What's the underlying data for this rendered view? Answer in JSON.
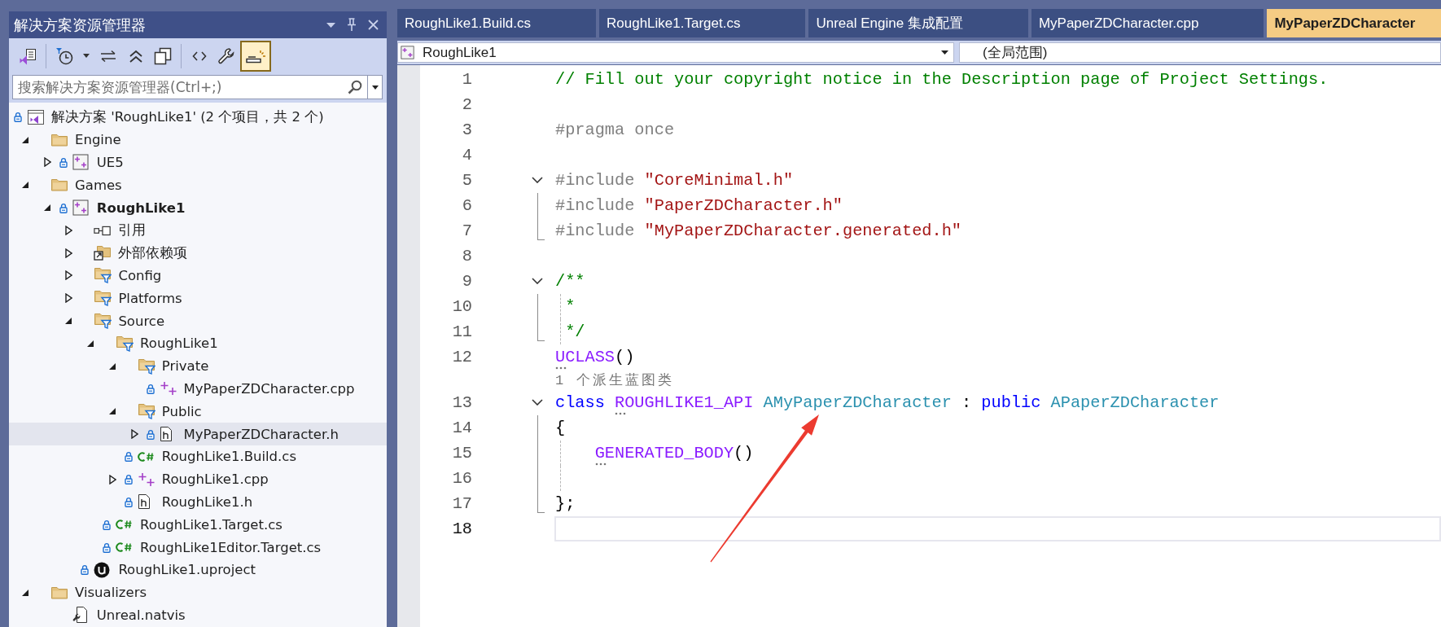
{
  "solution_explorer": {
    "title": "解决方案资源管理器",
    "toolbar": [
      [
        {
          "kind": "solution-view",
          "on": false
        }
      ],
      [
        {
          "kind": "history",
          "on": false
        },
        {
          "kind": "sync",
          "on": false
        },
        {
          "kind": "collapse",
          "on": false
        },
        {
          "kind": "copy",
          "on": false
        }
      ],
      [
        {
          "kind": "code",
          "on": false
        },
        {
          "kind": "properties",
          "on": false
        },
        {
          "kind": "preview",
          "on": true
        }
      ]
    ],
    "search": {
      "placeholder": "搜索解决方案资源管理器(Ctrl+;)"
    },
    "tree": [
      {
        "label": "解决方案 'RoughLike1' (2 个项目，共 2 个)",
        "kind": "solution",
        "locked": true,
        "startup": false,
        "selected": false,
        "children": [
          {
            "label": "Engine",
            "kind": "folder",
            "expanded": true,
            "locked": false,
            "startup": false,
            "selected": false,
            "children": [
              {
                "label": "UE5",
                "kind": "project",
                "expanded": false,
                "locked": true,
                "startup": false,
                "selected": false
              }
            ]
          },
          {
            "label": "Games",
            "kind": "folder",
            "expanded": true,
            "locked": false,
            "startup": false,
            "selected": false,
            "children": [
              {
                "label": "RoughLike1",
                "kind": "project",
                "expanded": true,
                "locked": true,
                "startup": true,
                "selected": false,
                "children": [
                  {
                    "label": "引用",
                    "kind": "references",
                    "expanded": false,
                    "locked": false,
                    "startup": false,
                    "selected": false
                  },
                  {
                    "label": "外部依赖项",
                    "kind": "external",
                    "expanded": false,
                    "locked": false,
                    "startup": false,
                    "selected": false
                  },
                  {
                    "label": "Config",
                    "kind": "filter",
                    "expanded": false,
                    "locked": false,
                    "startup": false,
                    "selected": false
                  },
                  {
                    "label": "Platforms",
                    "kind": "filter",
                    "expanded": false,
                    "locked": false,
                    "startup": false,
                    "selected": false
                  },
                  {
                    "label": "Source",
                    "kind": "filter",
                    "expanded": true,
                    "locked": false,
                    "startup": false,
                    "selected": false,
                    "children": [
                      {
                        "label": "RoughLike1",
                        "kind": "filter",
                        "expanded": true,
                        "locked": false,
                        "startup": false,
                        "selected": false,
                        "children": [
                          {
                            "label": "Private",
                            "kind": "filter",
                            "expanded": true,
                            "locked": false,
                            "startup": false,
                            "selected": false,
                            "children": [
                              {
                                "label": "MyPaperZDCharacter.cpp",
                                "kind": "cpp",
                                "locked": true,
                                "startup": false,
                                "selected": false
                              }
                            ]
                          },
                          {
                            "label": "Public",
                            "kind": "filter",
                            "expanded": true,
                            "locked": false,
                            "startup": false,
                            "selected": false,
                            "children": [
                              {
                                "label": "MyPaperZDCharacter.h",
                                "kind": "header",
                                "expanded": false,
                                "locked": true,
                                "startup": false,
                                "selected": true
                              }
                            ]
                          },
                          {
                            "label": "RoughLike1.Build.cs",
                            "kind": "csharp",
                            "locked": true,
                            "startup": false,
                            "selected": false
                          },
                          {
                            "label": "RoughLike1.cpp",
                            "kind": "cpp",
                            "expanded": false,
                            "locked": true,
                            "startup": false,
                            "selected": false
                          },
                          {
                            "label": "RoughLike1.h",
                            "kind": "header",
                            "locked": true,
                            "startup": false,
                            "selected": false
                          }
                        ]
                      },
                      {
                        "label": "RoughLike1.Target.cs",
                        "kind": "csharp",
                        "locked": true,
                        "startup": false,
                        "selected": false
                      },
                      {
                        "label": "RoughLike1Editor.Target.cs",
                        "kind": "csharp",
                        "locked": true,
                        "startup": false,
                        "selected": false
                      }
                    ]
                  },
                  {
                    "label": "RoughLike1.uproject",
                    "kind": "uproject",
                    "locked": true,
                    "startup": false,
                    "selected": false
                  }
                ]
              }
            ]
          },
          {
            "label": "Visualizers",
            "kind": "folder",
            "expanded": true,
            "locked": false,
            "startup": false,
            "selected": false,
            "children": [
              {
                "label": "Unreal.natvis",
                "kind": "natvis",
                "locked": false,
                "startup": false,
                "selected": false
              }
            ]
          }
        ]
      }
    ]
  },
  "editor": {
    "tabs": [
      {
        "label": "RoughLike1.Build.cs",
        "selected": false
      },
      {
        "label": "RoughLike1.Target.cs",
        "selected": false
      },
      {
        "label": "Unreal Engine 集成配置",
        "selected": false
      },
      {
        "label": "MyPaperZDCharacter.cpp",
        "selected": false
      },
      {
        "label": "MyPaperZDCharacter",
        "selected": true
      }
    ],
    "navigation": {
      "project": "RoughLike1",
      "scope": "(全局范围)"
    },
    "lines": [
      {
        "number": "1",
        "kind": "plain",
        "guide": false,
        "current": false,
        "tokens": [
          {
            "text": "// Fill out your copyright notice in the Description page of Project Settings.",
            "kind": "comment",
            "hint": false
          }
        ]
      },
      {
        "number": "2",
        "kind": "plain",
        "guide": false,
        "current": false
      },
      {
        "number": "3",
        "kind": "plain",
        "guide": false,
        "current": false,
        "tokens": [
          {
            "text": "#pragma once",
            "kind": "preprocessor",
            "hint": false
          }
        ]
      },
      {
        "number": "4",
        "kind": "plain",
        "guide": false,
        "current": false
      },
      {
        "number": "5",
        "kind": "opener",
        "guide": false,
        "current": false,
        "tokens": [
          {
            "text": "#include ",
            "kind": "preprocessor",
            "hint": false
          },
          {
            "text": "\"CoreMinimal.h\"",
            "kind": "string",
            "hint": false
          }
        ]
      },
      {
        "number": "6",
        "kind": "inner",
        "guide": false,
        "current": false,
        "tokens": [
          {
            "text": "#include ",
            "kind": "preprocessor",
            "hint": false
          },
          {
            "text": "\"PaperZDCharacter.h\"",
            "kind": "string",
            "hint": false
          }
        ]
      },
      {
        "number": "7",
        "kind": "closer",
        "guide": false,
        "current": false,
        "tokens": [
          {
            "text": "#include ",
            "kind": "preprocessor",
            "hint": false
          },
          {
            "text": "\"MyPaperZDCharacter.generated.h\"",
            "kind": "string",
            "hint": false
          }
        ]
      },
      {
        "number": "8",
        "kind": "plain",
        "guide": false,
        "current": false
      },
      {
        "number": "9",
        "kind": "opener",
        "guide": false,
        "current": false,
        "tokens": [
          {
            "text": "/**",
            "kind": "comment",
            "hint": false
          }
        ]
      },
      {
        "number": "10",
        "kind": "inner",
        "guide": true,
        "current": false,
        "tokens": [
          {
            "text": " *",
            "kind": "comment",
            "hint": false
          }
        ]
      },
      {
        "number": "11",
        "kind": "closer",
        "guide": true,
        "current": false,
        "tokens": [
          {
            "text": " */",
            "kind": "comment",
            "hint": false
          }
        ]
      },
      {
        "number": "12",
        "kind": "plain",
        "guide": false,
        "current": false,
        "tokens": [
          {
            "text": "UCLASS",
            "kind": "macro",
            "hint": true
          },
          {
            "text": "()",
            "kind": "plain",
            "hint": false
          }
        ]
      },
      {
        "number": "13",
        "kind": "opener",
        "guide": false,
        "current": false,
        "codelens": "1 个派生蓝图类",
        "tokens": [
          {
            "text": "class ",
            "kind": "keyword",
            "hint": false
          },
          {
            "text": "ROUGHLIKE1_API",
            "kind": "macro",
            "hint": true
          },
          {
            "text": " AMyPaperZDCharacter",
            "kind": "type",
            "hint": false
          },
          {
            "text": " : ",
            "kind": "plain",
            "hint": false
          },
          {
            "text": "public ",
            "kind": "keyword",
            "hint": false
          },
          {
            "text": "APaperZDCharacter",
            "kind": "type",
            "hint": false
          }
        ]
      },
      {
        "number": "14",
        "kind": "inner",
        "guide": false,
        "current": false,
        "tokens": [
          {
            "text": "{",
            "kind": "plain",
            "hint": false
          }
        ]
      },
      {
        "number": "15",
        "kind": "inner",
        "guide": true,
        "current": false,
        "tokens": [
          {
            "text": "    GENERATED_BODY",
            "kind": "macro",
            "hint": true
          },
          {
            "text": "()",
            "kind": "plain",
            "hint": false
          }
        ]
      },
      {
        "number": "16",
        "kind": "inner",
        "guide": true,
        "current": false
      },
      {
        "number": "17",
        "kind": "closer",
        "guide": false,
        "current": false,
        "tokens": [
          {
            "text": "};",
            "kind": "plain",
            "hint": false
          }
        ]
      },
      {
        "number": "18",
        "kind": "plain",
        "guide": false,
        "current": true
      }
    ],
    "annotations": [
      {
        "kind": "arrow"
      }
    ]
  }
}
